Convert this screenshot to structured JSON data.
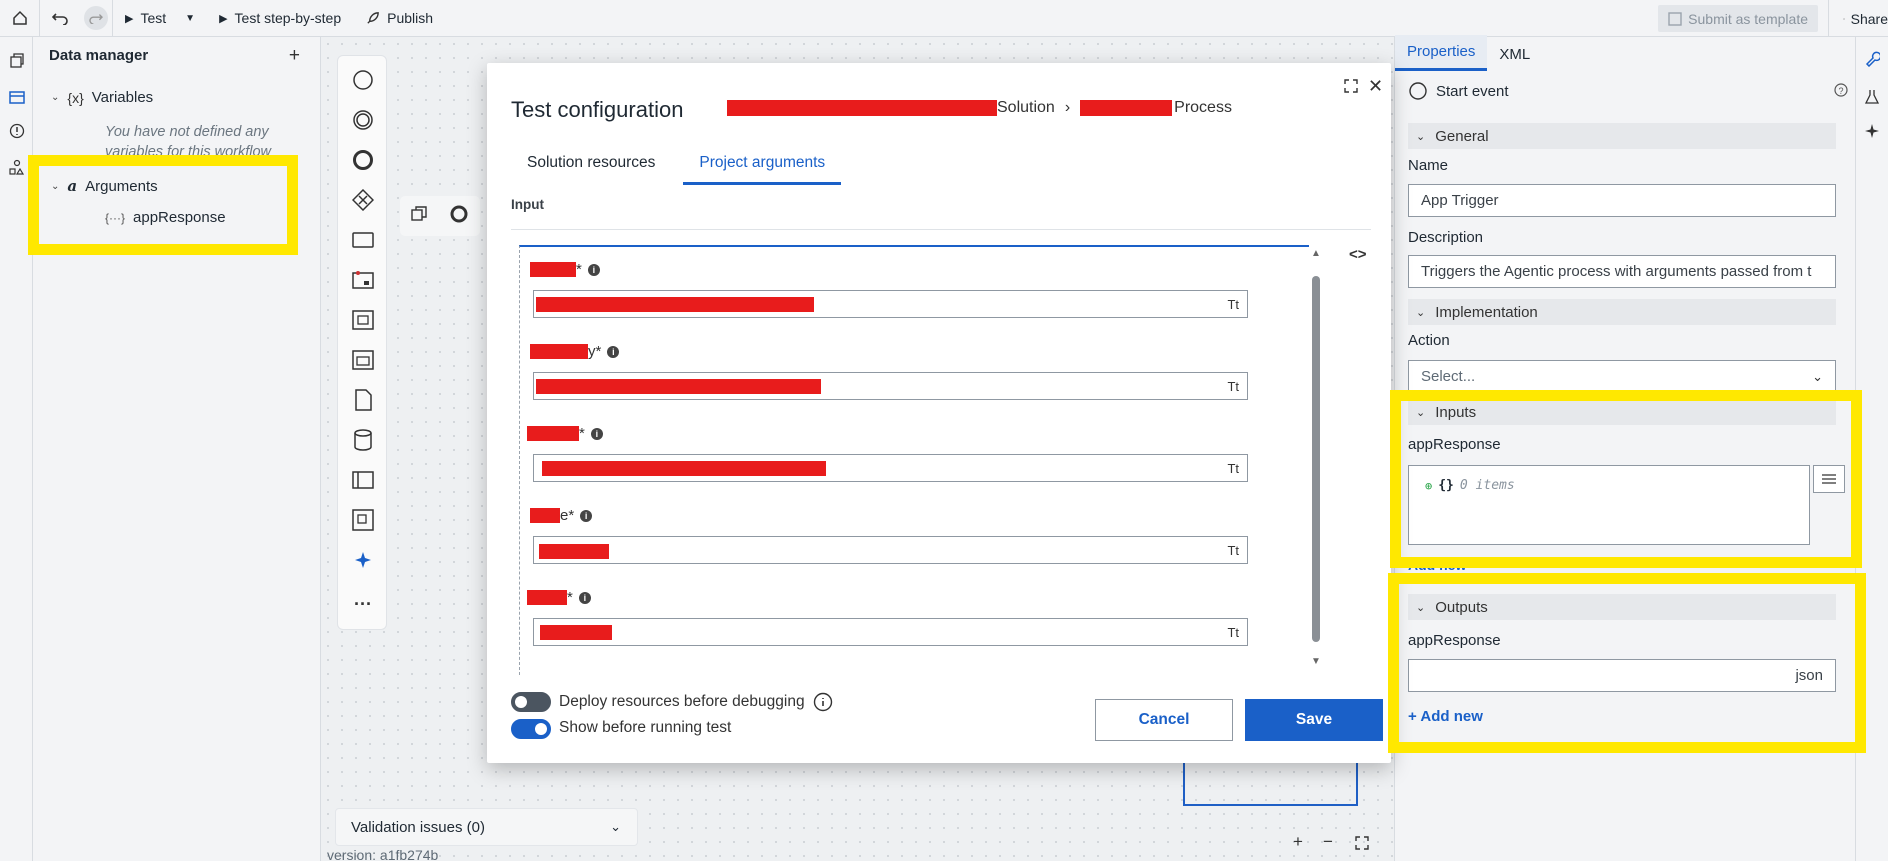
{
  "toolbar": {
    "test_label": "Test",
    "test_step_label": "Test step-by-step",
    "publish_label": "Publish",
    "submit_template_label": "Submit as template",
    "share_label": "Share"
  },
  "data_manager": {
    "title": "Data manager",
    "variables_label": "Variables",
    "variables_icon_text": "{x}",
    "variables_empty": "You have not defined any variables for this workflow",
    "arguments_label": "Arguments",
    "arguments_icon_text": "a",
    "argument_item": "appResponse",
    "argument_icon_text": "{···}"
  },
  "canvas": {
    "validation_label": "Validation issues (0)",
    "version_label": "version: a1fb274b"
  },
  "modal": {
    "title": "Test configuration",
    "crumb_solution": "Solution",
    "crumb_process": "Process",
    "tabs": [
      "Solution resources",
      "Project arguments"
    ],
    "active_tab": "Project arguments",
    "section_label": "Input",
    "args": [
      {
        "suffix": "*",
        "type_icon": "Tt"
      },
      {
        "suffix": "y*",
        "type_icon": "Tt"
      },
      {
        "suffix": "*",
        "type_icon": "Tt"
      },
      {
        "suffix": "e*",
        "type_icon": "Tt"
      },
      {
        "suffix": "*",
        "type_icon": "Tt"
      }
    ],
    "deploy_label": "Deploy resources before debugging",
    "show_label": "Show before running test",
    "deploy_on": false,
    "show_on": true,
    "cancel_label": "Cancel",
    "save_label": "Save"
  },
  "properties": {
    "tabs": [
      "Properties",
      "XML"
    ],
    "event_label": "Start event",
    "general_label": "General",
    "name_label": "Name",
    "name_value": "App Trigger",
    "description_label": "Description",
    "description_value": "Triggers the Agentic process with arguments passed from t",
    "implementation_label": "Implementation",
    "action_label": "Action",
    "action_placeholder": "Select...",
    "inputs_label": "Inputs",
    "inputs_item": "appResponse",
    "inputs_braces": "{}",
    "inputs_count": "0 items",
    "add_new_hidden": "Add new",
    "outputs_label": "Outputs",
    "outputs_item": "appResponse",
    "outputs_type": "json",
    "add_new_label": "+ Add new"
  },
  "colors": {
    "accent": "#1a60c8",
    "highlight": "#ffe800",
    "redaction": "#e81c1c"
  }
}
